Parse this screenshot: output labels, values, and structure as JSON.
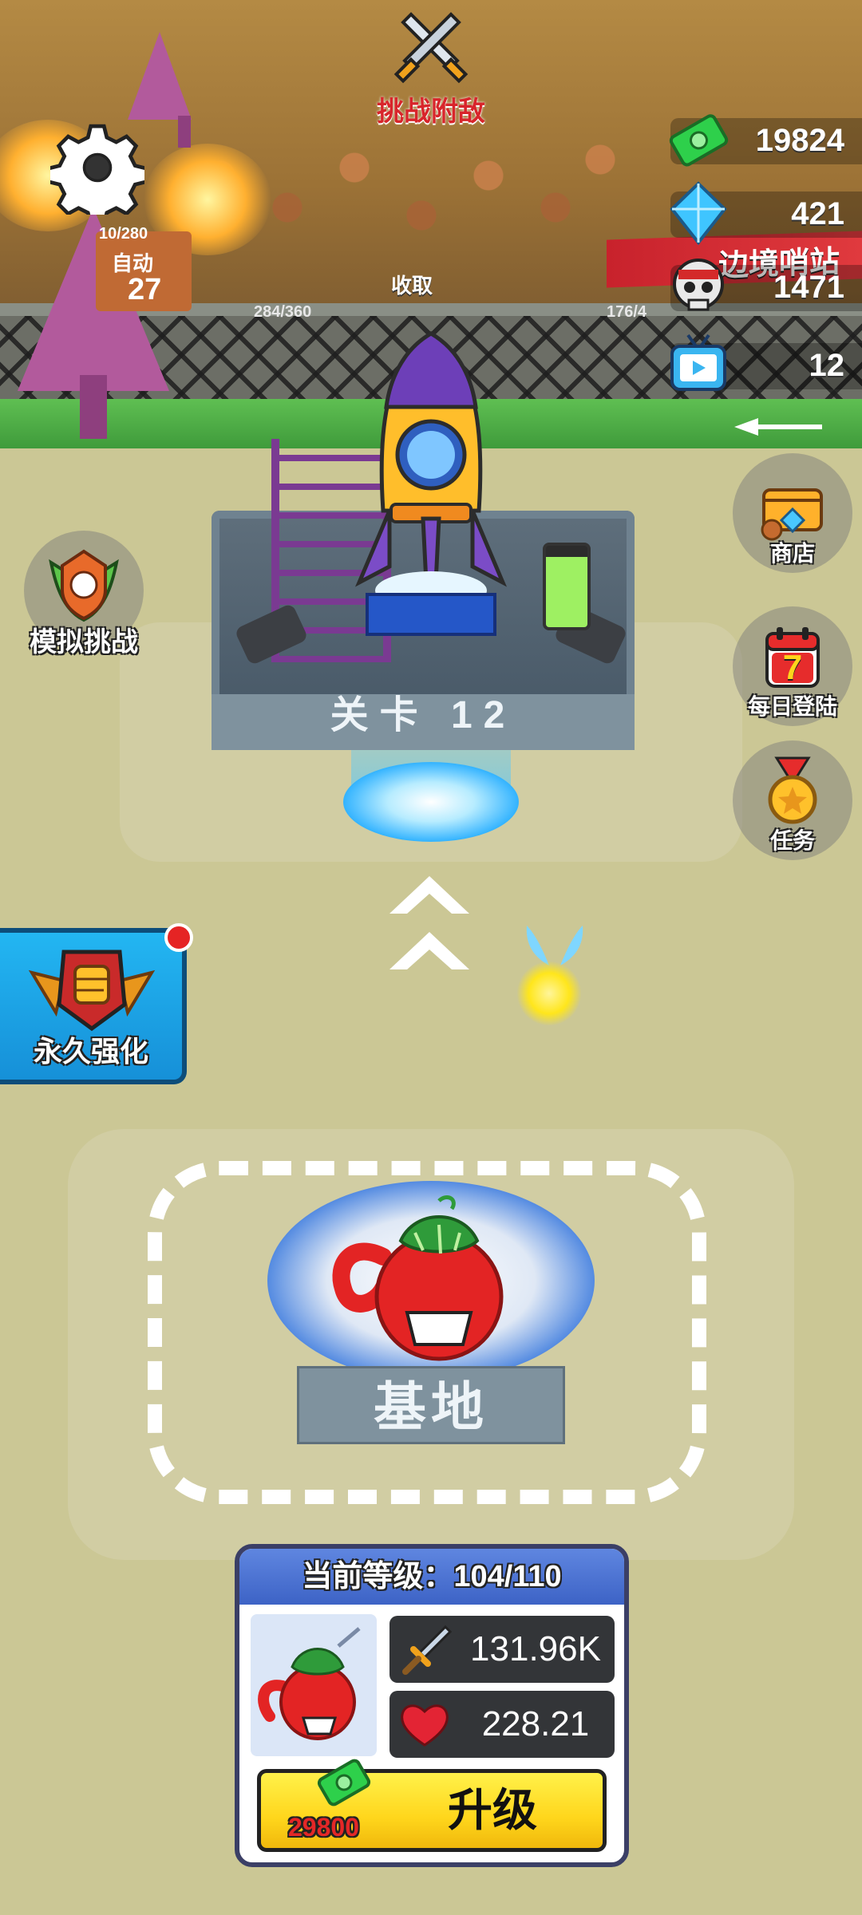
{
  "challenge": {
    "label": "挑战附敌"
  },
  "resources": {
    "cash": "19824",
    "gems": "421",
    "skulls": "1471",
    "videos": "12"
  },
  "scene": {
    "collect_label": "收取",
    "border_post_label": "边境哨站",
    "left_counter": "10/280",
    "left_counter_sub": "自动",
    "left_counter_num": "27",
    "score_left": "284/360",
    "score_right": "176/4"
  },
  "side_buttons": {
    "shop": "商店",
    "daily_login": "每日登陆",
    "daily_login_day": "7",
    "tasks": "任务",
    "sim_challenge": "模拟挑战",
    "permanent_upgrade": "永久强化"
  },
  "stage": {
    "level_label": "关卡 12"
  },
  "base": {
    "label": "基地"
  },
  "level_card": {
    "title": "当前等级：104/110",
    "attack": "131.96K",
    "hp": "228.21",
    "upgrade_cost": "29800",
    "upgrade_label": "升级"
  },
  "colors": {
    "ground": "#cbc795",
    "pad": "#d1cda3",
    "accent_blue": "#23b6f2",
    "upgrade_yellow": "#ffd61c",
    "cost_red": "#e42727"
  }
}
